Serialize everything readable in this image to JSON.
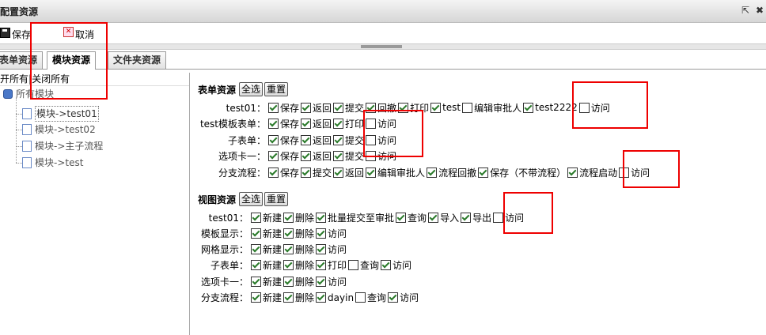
{
  "window": {
    "title": "配置资源",
    "popout_icon": "popout-icon",
    "close_icon": "close-icon",
    "popout_glyph": "⇱",
    "close_glyph": "✖"
  },
  "toolbar": {
    "save_label": "保存",
    "cancel_label": "取消",
    "save_icon": "save-icon",
    "cancel_icon": "cancel-icon"
  },
  "tabs": [
    {
      "label": "表单资源"
    },
    {
      "label": "模块资源"
    },
    {
      "label": "文件夹资源"
    }
  ],
  "tree": {
    "expand_all": "开所有",
    "separator": "|",
    "collapse_all": "关闭所有",
    "root_label": "所有模块",
    "items": [
      {
        "label": "模块->test01"
      },
      {
        "label": "模块->test02"
      },
      {
        "label": "模块->主子流程"
      },
      {
        "label": "模块->test"
      }
    ]
  },
  "form_section": {
    "title": "表单资源",
    "select_all": "全选",
    "reset": "重置",
    "rows": [
      {
        "label": "test01：",
        "items": [
          {
            "t": "保存",
            "c": true
          },
          {
            "t": "返回",
            "c": true
          },
          {
            "t": "提交",
            "c": true
          },
          {
            "t": "回撤",
            "c": true
          },
          {
            "t": "打印",
            "c": true
          },
          {
            "t": "test",
            "c": true
          },
          {
            "t": "编辑审批人",
            "c": false
          },
          {
            "t": "test2222",
            "c": true
          },
          {
            "t": "访问",
            "c": false
          }
        ]
      },
      {
        "label": "test模板表单：",
        "items": [
          {
            "t": "保存",
            "c": true
          },
          {
            "t": "返回",
            "c": true
          },
          {
            "t": "打印",
            "c": true
          },
          {
            "t": "访问",
            "c": false
          }
        ]
      },
      {
        "label": "子表单：",
        "items": [
          {
            "t": "保存",
            "c": true
          },
          {
            "t": "返回",
            "c": true
          },
          {
            "t": "提交",
            "c": true
          },
          {
            "t": "访问",
            "c": false
          }
        ]
      },
      {
        "label": "选项卡一：",
        "items": [
          {
            "t": "保存",
            "c": true
          },
          {
            "t": "返回",
            "c": true
          },
          {
            "t": "提交",
            "c": true
          },
          {
            "t": "访问",
            "c": false
          }
        ]
      },
      {
        "label": "分支流程：",
        "items": [
          {
            "t": "保存",
            "c": true
          },
          {
            "t": "提交",
            "c": true
          },
          {
            "t": "返回",
            "c": true
          },
          {
            "t": "编辑审批人",
            "c": true
          },
          {
            "t": "流程回撤",
            "c": true
          },
          {
            "t": "保存（不带流程）",
            "c": true
          },
          {
            "t": "流程启动",
            "c": true
          },
          {
            "t": "访问",
            "c": false
          }
        ]
      }
    ]
  },
  "view_section": {
    "title": "视图资源",
    "select_all": "全选",
    "reset": "重置",
    "rows": [
      {
        "label": "test01：",
        "items": [
          {
            "t": "新建",
            "c": true
          },
          {
            "t": "删除",
            "c": true
          },
          {
            "t": "批量提交至审批",
            "c": true
          },
          {
            "t": "查询",
            "c": true
          },
          {
            "t": "导入",
            "c": true
          },
          {
            "t": "导出",
            "c": true
          },
          {
            "t": "访问",
            "c": false
          }
        ]
      },
      {
        "label": "模板显示：",
        "items": [
          {
            "t": "新建",
            "c": true
          },
          {
            "t": "删除",
            "c": true
          },
          {
            "t": "访问",
            "c": true
          }
        ]
      },
      {
        "label": "网格显示：",
        "items": [
          {
            "t": "新建",
            "c": true
          },
          {
            "t": "删除",
            "c": true
          },
          {
            "t": "访问",
            "c": true
          }
        ]
      },
      {
        "label": "子表单：",
        "items": [
          {
            "t": "新建",
            "c": true
          },
          {
            "t": "删除",
            "c": true
          },
          {
            "t": "打印",
            "c": true
          },
          {
            "t": "查询",
            "c": false
          },
          {
            "t": "访问",
            "c": true
          }
        ]
      },
      {
        "label": "选项卡一：",
        "items": [
          {
            "t": "新建",
            "c": true
          },
          {
            "t": "删除",
            "c": true
          },
          {
            "t": "访问",
            "c": true
          }
        ]
      },
      {
        "label": "分支流程：",
        "items": [
          {
            "t": "新建",
            "c": true
          },
          {
            "t": "删除",
            "c": true
          },
          {
            "t": "dayin",
            "c": true
          },
          {
            "t": "查询",
            "c": false
          },
          {
            "t": "访问",
            "c": true
          }
        ]
      }
    ]
  },
  "colors": {
    "highlight": "#e00000",
    "check": "#2a7a2a"
  }
}
